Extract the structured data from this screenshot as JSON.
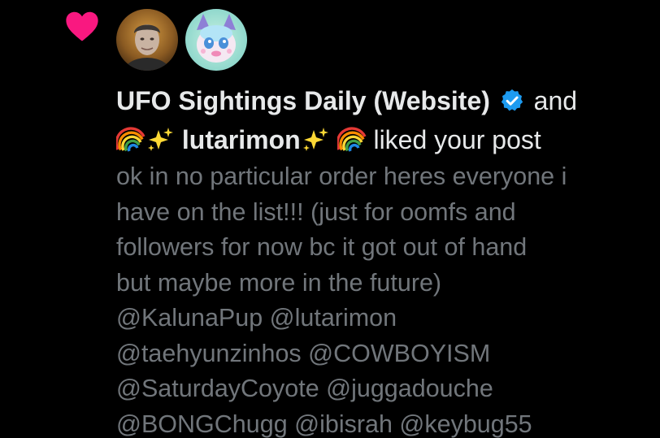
{
  "notification": {
    "type_icon": "heart-icon",
    "accent_color": "#f91880",
    "verified_color": "#1d9bf0",
    "avatars": [
      {
        "name": "avatar-ufo-sightings-daily"
      },
      {
        "name": "avatar-lutarimon"
      }
    ],
    "user1_name": "UFO Sightings Daily (Website)",
    "connector": "and",
    "user2_name": "lutarimon",
    "action_text": "liked your post",
    "post_lines": [
      "ok in no particular order heres everyone i",
      "have on the list!!! (just for oomfs and",
      "followers for now bc it got out of hand",
      "but maybe more in the future)",
      "@KalunaPup @lutarimon",
      "@taehyunzinhos @COWBOYISM",
      "@SaturdayCoyote @juggadouche",
      "@BONGChugg @ibisrah @keybug55"
    ]
  }
}
